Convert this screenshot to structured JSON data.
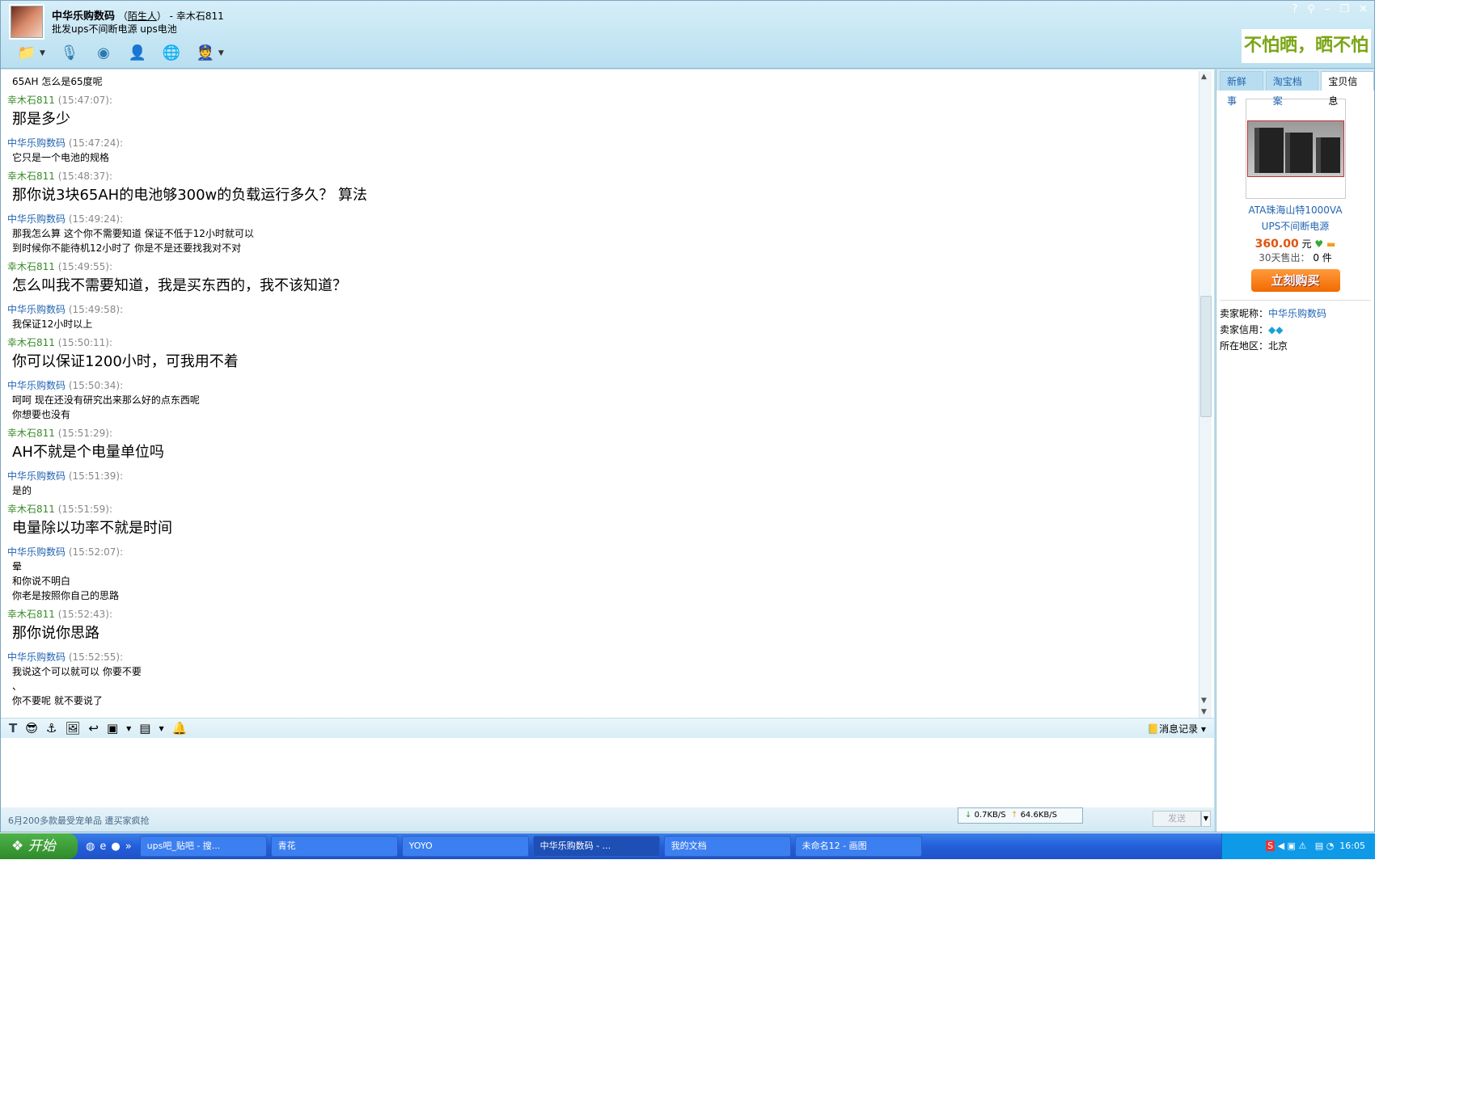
{
  "header": {
    "contact_name": "中华乐购数码",
    "relation": "陌生人",
    "self_name": "幸木石811",
    "signature": "批发ups不间断电源  ups电池",
    "banner": "不怕晒，晒不怕",
    "tools": [
      "send-file-icon",
      "voice-icon",
      "video-icon",
      "add-contact-icon",
      "remote-assist-icon",
      "app-icon"
    ]
  },
  "messages": [
    {
      "first_line_only": true,
      "lines": [
        "65AH 怎么是65度呢"
      ],
      "big": false
    },
    {
      "sender": "幸木石811",
      "who": "me",
      "time": "(15:47:07):",
      "lines": [
        "那是多少"
      ],
      "big": true
    },
    {
      "sender": "中华乐购数码",
      "who": "them",
      "time": "(15:47:24):",
      "lines": [
        "它只是一个电池的规格"
      ],
      "big": false
    },
    {
      "sender": "幸木石811",
      "who": "me",
      "time": "(15:48:37):",
      "lines": [
        "那你说3块65AH的电池够300w的负载运行多久？ 算法"
      ],
      "big": true
    },
    {
      "sender": "中华乐购数码",
      "who": "them",
      "time": "(15:49:24):",
      "lines": [
        "那我怎么算  这个你不需要知道  保证不低于12小时就可以",
        "到时候你不能待机12小时了  你是不是还要找我对不对"
      ],
      "big": false
    },
    {
      "sender": "幸木石811",
      "who": "me",
      "time": "(15:49:55):",
      "lines": [
        "怎么叫我不需要知道，我是买东西的，我不该知道？"
      ],
      "big": true
    },
    {
      "sender": "中华乐购数码",
      "who": "them",
      "time": "(15:49:58):",
      "lines": [
        "我保证12小时以上"
      ],
      "big": false
    },
    {
      "sender": "幸木石811",
      "who": "me",
      "time": "(15:50:11):",
      "lines": [
        "你可以保证1200小时，可我用不着"
      ],
      "big": true
    },
    {
      "sender": "中华乐购数码",
      "who": "them",
      "time": "(15:50:34):",
      "lines": [
        "呵呵  现在还没有研究出来那么好的点东西呢",
        "你想要也没有"
      ],
      "big": false
    },
    {
      "sender": "幸木石811",
      "who": "me",
      "time": "(15:51:29):",
      "lines": [
        "AH不就是个电量单位吗"
      ],
      "big": true
    },
    {
      "sender": "中华乐购数码",
      "who": "them",
      "time": "(15:51:39):",
      "lines": [
        "是的"
      ],
      "big": false
    },
    {
      "sender": "幸木石811",
      "who": "me",
      "time": "(15:51:59):",
      "lines": [
        "电量除以功率不就是时间"
      ],
      "big": true
    },
    {
      "sender": "中华乐购数码",
      "who": "them",
      "time": "(15:52:07):",
      "lines": [
        "晕",
        "和你说不明白",
        "你老是按照你自己的思路"
      ],
      "big": false
    },
    {
      "sender": "幸木石811",
      "who": "me",
      "time": "(15:52:43):",
      "lines": [
        "那你说你思路"
      ],
      "big": true
    },
    {
      "sender": "中华乐购数码",
      "who": "them",
      "time": "(15:52:55):",
      "lines": [
        "我说这个可以就可以  你要不要",
        "、",
        "你不要呢  就不要说了"
      ],
      "big": false
    }
  ],
  "toolbar": {
    "history_label": "消息记录"
  },
  "status": {
    "ad_text": "6月200多款最受宠单品 遭买家疯抢",
    "download": "0.7KB/S",
    "upload": "64.6KB/S",
    "send_label": "发送"
  },
  "side": {
    "tabs": [
      "新鲜事",
      "淘宝档案",
      "宝贝信息"
    ],
    "active_tab": 2,
    "product_name_1": "ATA珠海山特1000VA",
    "product_name_2": "UPS不间断电源",
    "price": "360.00",
    "currency": "元",
    "sold_label": "30天售出：",
    "sold_value": "0 件",
    "buy_label": "立刻购买",
    "seller_label": "卖家昵称：",
    "seller": "中华乐购数码",
    "credit_label": "卖家信用：",
    "location_label": "所在地区：",
    "location": "北京"
  },
  "taskbar": {
    "start": "开始",
    "tasks": [
      "ups吧_贴吧 - 搜...",
      "青花",
      "YOYO",
      "中华乐购数码 - ...",
      "我的文档",
      "未命名12 - 画图"
    ],
    "active_task": 3,
    "clock": "16:05"
  },
  "colors": {
    "me": "#3a8a2a",
    "them": "#2264b0",
    "price": "#e0540c"
  }
}
